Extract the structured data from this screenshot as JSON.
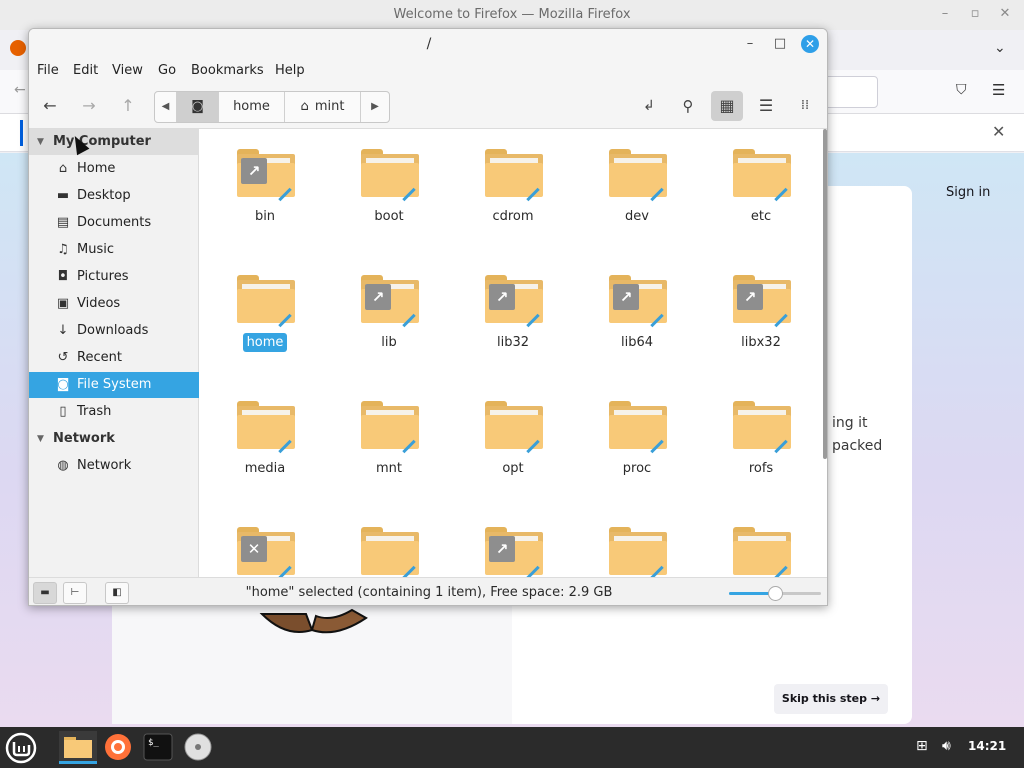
{
  "firefox": {
    "window_title": "Welcome to Firefox — Mozilla Firefox",
    "sign_in": "Sign in",
    "body_line1": "ing it",
    "body_line2": "packed",
    "skip_button": "Skip this step →"
  },
  "nemo": {
    "title": "/",
    "menu": [
      "File",
      "Edit",
      "View",
      "Go",
      "Bookmarks",
      "Help"
    ],
    "path_segments": [
      "home",
      "mint"
    ],
    "sidebar": {
      "sections": [
        {
          "title": "My Computer",
          "items": [
            {
              "label": "Home",
              "icon": "home-icon"
            },
            {
              "label": "Desktop",
              "icon": "desktop-icon"
            },
            {
              "label": "Documents",
              "icon": "documents-icon"
            },
            {
              "label": "Music",
              "icon": "music-icon"
            },
            {
              "label": "Pictures",
              "icon": "pictures-icon"
            },
            {
              "label": "Videos",
              "icon": "videos-icon"
            },
            {
              "label": "Downloads",
              "icon": "downloads-icon"
            },
            {
              "label": "Recent",
              "icon": "recent-icon"
            },
            {
              "label": "File System",
              "icon": "filesystem-icon",
              "selected": true
            },
            {
              "label": "Trash",
              "icon": "trash-icon"
            }
          ]
        },
        {
          "title": "Network",
          "items": [
            {
              "label": "Network",
              "icon": "network-icon"
            }
          ]
        }
      ]
    },
    "files": [
      {
        "name": "bin",
        "emblem": "symlink"
      },
      {
        "name": "boot"
      },
      {
        "name": "cdrom"
      },
      {
        "name": "dev"
      },
      {
        "name": "etc"
      },
      {
        "name": "home",
        "selected": true
      },
      {
        "name": "lib",
        "emblem": "symlink"
      },
      {
        "name": "lib32",
        "emblem": "symlink"
      },
      {
        "name": "lib64",
        "emblem": "symlink"
      },
      {
        "name": "libx32",
        "emblem": "symlink"
      },
      {
        "name": "media"
      },
      {
        "name": "mnt"
      },
      {
        "name": "opt"
      },
      {
        "name": "proc"
      },
      {
        "name": "rofs"
      },
      {
        "name": "",
        "emblem": "unreadable"
      },
      {
        "name": ""
      },
      {
        "name": "",
        "emblem": "symlink"
      },
      {
        "name": ""
      },
      {
        "name": ""
      }
    ],
    "status": "\"home\" selected (containing 1 item), Free space: 2.9 GB",
    "zoom_level": 0.5,
    "accent_color": "#35a4e2"
  },
  "taskbar": {
    "clock": "14:21"
  }
}
